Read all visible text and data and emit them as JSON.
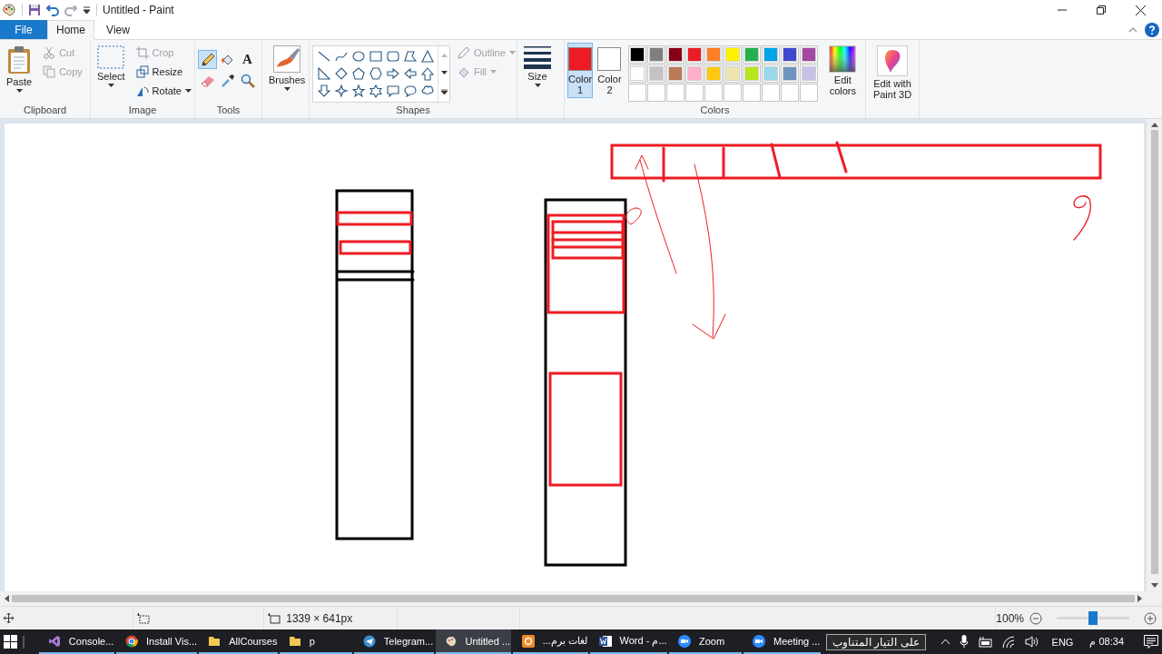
{
  "window": {
    "title": "Untitled - Paint"
  },
  "tabs": [
    {
      "label": "File",
      "kind": "file",
      "selected": false
    },
    {
      "label": "Home",
      "kind": "tab",
      "selected": true
    },
    {
      "label": "View",
      "kind": "tab",
      "selected": false
    }
  ],
  "clipboard": {
    "label": "Clipboard",
    "paste": "Paste",
    "cut": {
      "label": "Cut",
      "disabled": true
    },
    "copy": {
      "label": "Copy",
      "disabled": true
    }
  },
  "image": {
    "label": "Image",
    "select": "Select",
    "crop": {
      "label": "Crop",
      "disabled": true
    },
    "resize": {
      "label": "Resize",
      "disabled": false
    },
    "rotate": {
      "label": "Rotate",
      "disabled": false
    }
  },
  "tools": {
    "label": "Tools",
    "items": [
      {
        "kind": "pencil",
        "selected": true
      },
      {
        "kind": "fill",
        "selected": false
      },
      {
        "kind": "text",
        "selected": false
      },
      {
        "kind": "eraser",
        "selected": false
      },
      {
        "kind": "picker",
        "selected": false
      },
      {
        "kind": "magnifier",
        "selected": false
      }
    ],
    "text_glyph": "A"
  },
  "brushes": {
    "label": "Brushes"
  },
  "shapes": {
    "label": "Shapes",
    "outline": {
      "label": "Outline",
      "disabled": true
    },
    "fill": {
      "label": "Fill",
      "disabled": true
    }
  },
  "size": {
    "label": "Size"
  },
  "colors": {
    "label": "Colors",
    "slots": [
      {
        "label": "Color",
        "number": "1",
        "color": "#ed1c24",
        "selected": true
      },
      {
        "label": "Color",
        "number": "2",
        "color": "#ffffff",
        "selected": false
      }
    ],
    "palette": [
      {
        "color": "#000000"
      },
      {
        "color": "#7f7f7f"
      },
      {
        "color": "#880015"
      },
      {
        "color": "#ed1c24"
      },
      {
        "color": "#ff7f27"
      },
      {
        "color": "#fff200"
      },
      {
        "color": "#22b14c"
      },
      {
        "color": "#00a2e8"
      },
      {
        "color": "#3f48cc"
      },
      {
        "color": "#a349a4"
      },
      {
        "color": "#ffffff"
      },
      {
        "color": "#c3c3c3"
      },
      {
        "color": "#b97a57"
      },
      {
        "color": "#ffaec9"
      },
      {
        "color": "#ffc90e"
      },
      {
        "color": "#efe4b0"
      },
      {
        "color": "#b5e61d"
      },
      {
        "color": "#99d9ea"
      },
      {
        "color": "#7092be"
      },
      {
        "color": "#c8bfe7"
      }
    ],
    "edit_colors": "Edit colors"
  },
  "paint3d": {
    "label": "Edit with Paint 3D"
  },
  "status_bar": {
    "dimensions": "1339 × 641px",
    "zoom": "100%",
    "zoom_level": {
      "level": 0.5
    }
  },
  "taskbar": {
    "items": [
      {
        "label": "Console...",
        "kind": "vs",
        "selected": false
      },
      {
        "label": "Install Vis...",
        "kind": "chrome",
        "selected": false
      },
      {
        "label": "AllCourses",
        "kind": "folder",
        "selected": false
      },
      {
        "label": "p",
        "kind": "folder",
        "selected": false
      },
      {
        "label": "Telegram...",
        "kind": "telegram",
        "selected": false
      },
      {
        "label": "Untitled ...",
        "kind": "paint",
        "selected": true
      },
      {
        "label": "لغات برم...",
        "kind": "orange",
        "selected": false
      },
      {
        "label": "Word - م...",
        "kind": "word",
        "selected": false
      },
      {
        "label": "Zoom",
        "kind": "zoom",
        "selected": false
      },
      {
        "label": "Meeting ...",
        "kind": "zoom",
        "selected": false
      }
    ],
    "tooltip": "على التيار المتناوب",
    "language": "ENG",
    "time": "08:34 م"
  }
}
